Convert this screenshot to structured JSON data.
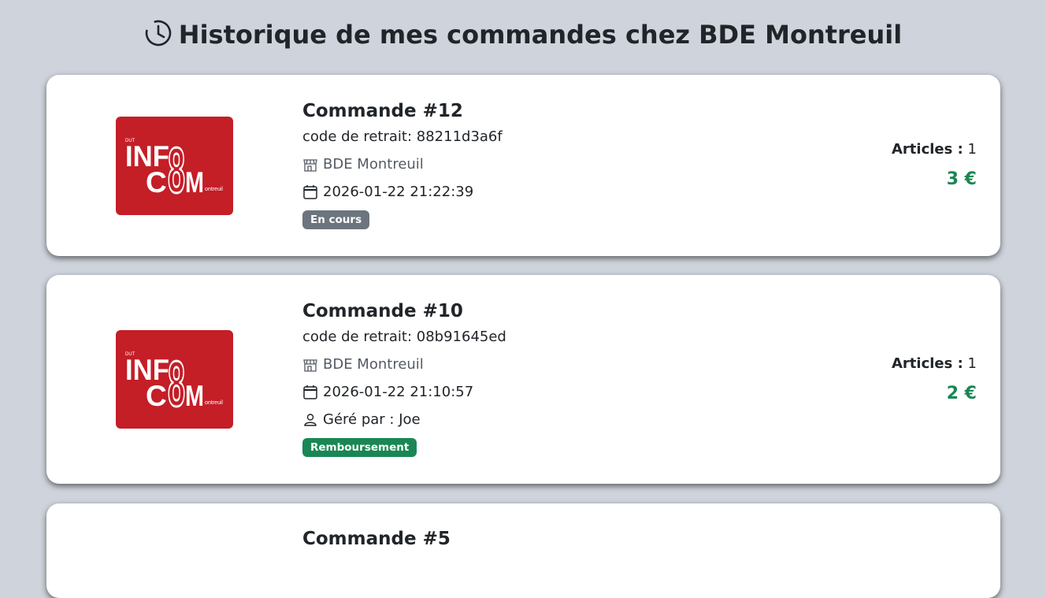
{
  "header": {
    "title": "Historique de mes commandes chez BDE Montreuil",
    "icon": "history-clock-icon"
  },
  "logo": {
    "top": "DUT",
    "line1": "INF",
    "line2": "C",
    "letter_m": "M",
    "sub": "ontreuil",
    "big_digit": "8",
    "color": "#c41e27"
  },
  "orders": [
    {
      "title": "Commande #12",
      "code": "code de retrait: 88211d3a6f",
      "shop": "BDE Montreuil",
      "date": "2026-01-22 21:22:39",
      "status": "En cours",
      "status_color": "#6c757d",
      "articles_label": "Articles :",
      "articles_count": "1",
      "price": "3 €"
    },
    {
      "title": "Commande #10",
      "code": "code de retrait: 08b91645ed",
      "shop": "BDE Montreuil",
      "date": "2026-01-22 21:10:57",
      "manager": "Géré par : Joe",
      "status": "Remboursement",
      "status_color": "#198754",
      "articles_label": "Articles :",
      "articles_count": "1",
      "price": "2 €"
    },
    {
      "title": "Commande #5"
    }
  ]
}
